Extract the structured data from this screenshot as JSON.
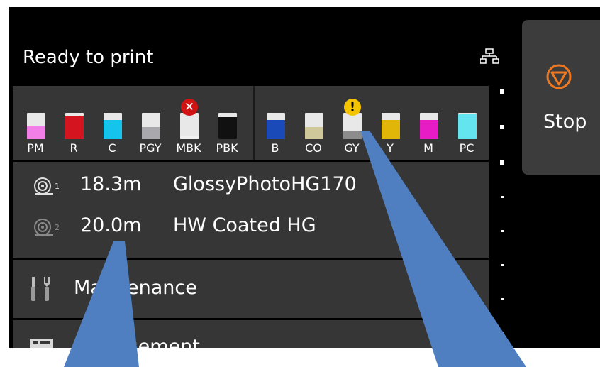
{
  "status": {
    "text": "Ready to print"
  },
  "icons": {
    "network": "network-icon",
    "stop": "stop-icon",
    "roll1": "roll-paper-1-icon",
    "roll2": "roll-paper-2-icon",
    "maintenance": "maintenance-tools-icon",
    "management": "management-icon"
  },
  "ink_group_1": [
    {
      "label": "PM",
      "color": "#f27ee8",
      "level": 0.5,
      "alert": ""
    },
    {
      "label": "R",
      "color": "#d4141e",
      "level": 0.9,
      "alert": ""
    },
    {
      "label": "C",
      "color": "#15c4ec",
      "level": 0.72,
      "alert": ""
    },
    {
      "label": "PGY",
      "color": "#a9a9ad",
      "level": 0.45,
      "alert": ""
    },
    {
      "label": "MBK",
      "color": "#f0f0f0",
      "level": 0.1,
      "alert": "error"
    },
    {
      "label": "PBK",
      "color": "#111111",
      "level": 0.85,
      "alert": ""
    }
  ],
  "ink_group_2": [
    {
      "label": "B",
      "color": "#1a4ab8",
      "level": 0.72,
      "alert": ""
    },
    {
      "label": "CO",
      "color": "#cfc89a",
      "level": 0.45,
      "alert": ""
    },
    {
      "label": "GY",
      "color": "#8c8c8c",
      "level": 0.3,
      "alert": "warning"
    },
    {
      "label": "Y",
      "color": "#e2b509",
      "level": 0.72,
      "alert": ""
    },
    {
      "label": "M",
      "color": "#e81cc4",
      "level": 0.72,
      "alert": ""
    },
    {
      "label": "PC",
      "color": "#63e4ef",
      "level": 0.95,
      "alert": ""
    }
  ],
  "alert_symbols": {
    "error": "✕",
    "warning": "!"
  },
  "paper": [
    {
      "length": "18.3m",
      "name": "GlossyPhotoHG170"
    },
    {
      "length": "20.0m",
      "name": "HW Coated HG"
    }
  ],
  "menu": {
    "maintenance": "Maintenance",
    "management": "Management"
  },
  "stop_button": {
    "label": "Stop"
  },
  "colors": {
    "screen_background": "#000000",
    "panel": "#363636",
    "stop_accent": "#f07820",
    "callout": "#4f7fc0"
  }
}
